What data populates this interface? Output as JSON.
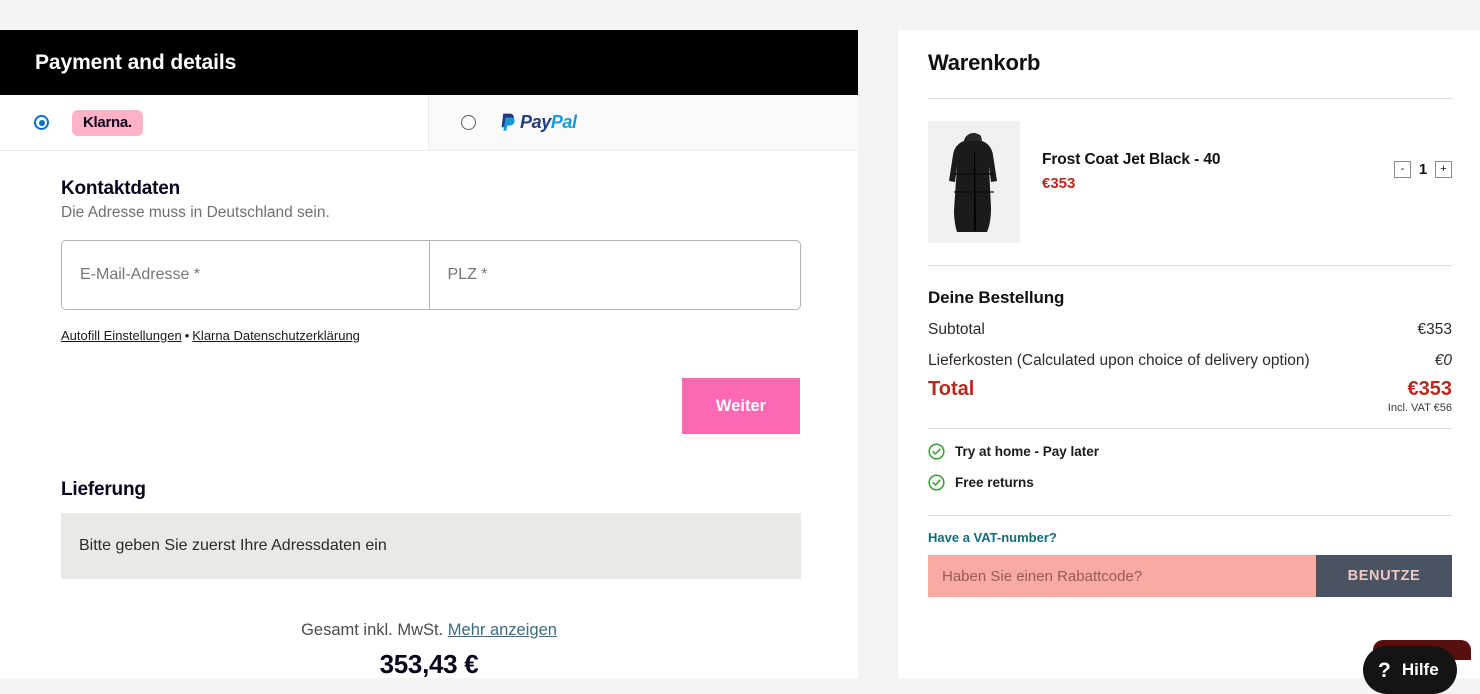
{
  "klarna_panel": {
    "header_title": "Payment and details",
    "payment_methods": [
      {
        "id": "klarna",
        "label": "Klarna.",
        "selected": true
      },
      {
        "id": "paypal",
        "label": "PayPal",
        "selected": false
      }
    ],
    "contact": {
      "title": "Kontaktdaten",
      "subtitle": "Die Adresse muss in Deutschland sein.",
      "email_placeholder": "E-Mail-Adresse *",
      "email_value": "",
      "zip_placeholder": "PLZ *",
      "zip_value": ""
    },
    "legal": {
      "autofill_link": "Autofill Einstellungen",
      "separator": "•",
      "privacy_link": "Klarna Datenschutzerklärung"
    },
    "continue_button": "Weiter",
    "delivery": {
      "title": "Lieferung",
      "message": "Bitte geben Sie zuerst Ihre Adressdaten ein"
    },
    "grand_total": {
      "label": "Gesamt inkl. MwSt.",
      "more_link": "Mehr anzeigen",
      "amount": "353,43 €"
    }
  },
  "cart_panel": {
    "title": "Warenkorb",
    "item": {
      "name": "Frost Coat Jet Black - 40",
      "price": "€353",
      "quantity": "1",
      "decrease_label": "-",
      "increase_label": "+",
      "image_alt": "black-long-puffer-coat"
    },
    "order": {
      "title": "Deine Bestellung",
      "rows": [
        {
          "label": "Subtotal",
          "value": "€353"
        },
        {
          "label": "Lieferkosten (Calculated upon choice of delivery option)",
          "value": "€0"
        }
      ],
      "total_label": "Total",
      "total_value": "€353",
      "vat_note": "Incl. VAT €56"
    },
    "benefits": [
      {
        "text": "Try at home - Pay later"
      },
      {
        "text": "Free returns"
      }
    ],
    "vat_number_link": "Have a VAT-number?",
    "discount": {
      "placeholder": "Haben Sie einen Rabattcode?",
      "value": "",
      "apply_label": "BENUTZE"
    }
  },
  "help_widget": {
    "icon": "question-mark",
    "label": "Hilfe"
  },
  "colors": {
    "klarna_pink": "#FFB3C7",
    "continue_pink": "#FF69B4",
    "accent_red": "#B52B1F",
    "teal_link": "#126B7A",
    "discount_bg": "#F9AAA4",
    "apply_bg": "#495361",
    "check_green": "#3A9B35",
    "radio_blue": "#0B6ECD"
  }
}
